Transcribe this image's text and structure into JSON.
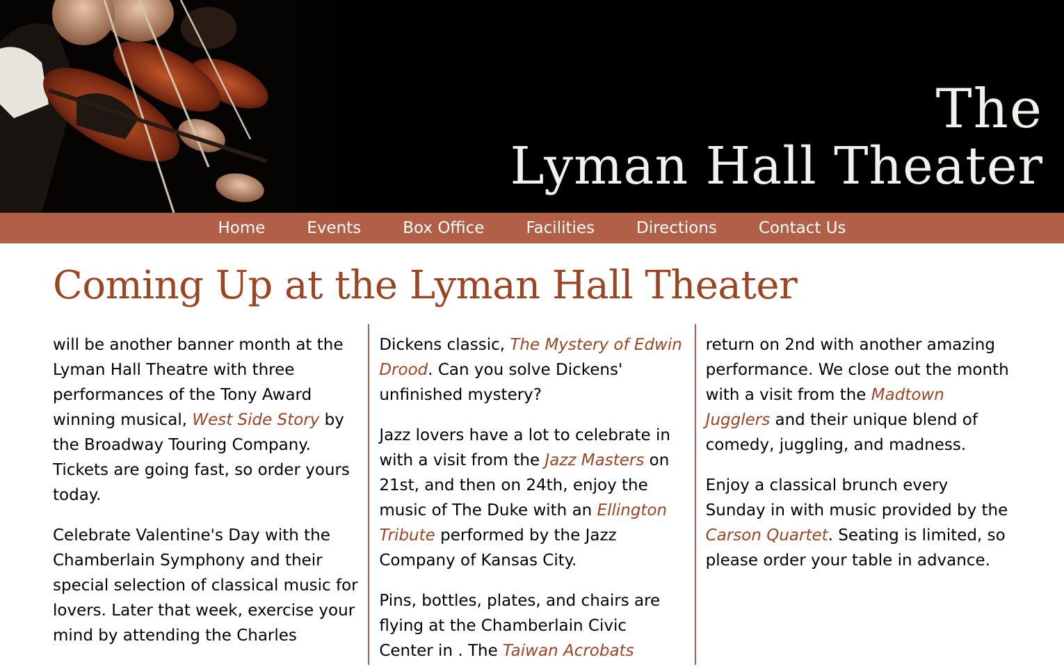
{
  "banner": {
    "title_line1": "The",
    "title_line2": "Lyman Hall Theater",
    "photo_alt": "Violinists performing"
  },
  "nav": {
    "items": [
      "Home",
      "Events",
      "Box Office",
      "Facilities",
      "Directions",
      "Contact Us"
    ]
  },
  "main": {
    "heading": "Coming Up at the Lyman Hall Theater",
    "col1": {
      "p1_a": "will be another banner month at the Lyman Hall Theatre with three performances of the Tony Award winning musical, ",
      "p1_link": "West Side Story",
      "p1_b": " by the Broadway Touring Company. Tickets are going fast, so order yours today.",
      "p2": "Celebrate Valentine's Day with the Chamberlain Symphony and their special selection of classical music for lovers. Later that week, exercise your mind by attending the Charles"
    },
    "col2": {
      "p1_a": "Dickens classic, ",
      "p1_link": "The Mystery of Edwin Drood",
      "p1_b": ". Can you solve Dickens' unfinished mystery?",
      "p2_a": "Jazz lovers have a lot to celebrate in with a visit from the ",
      "p2_link1": "Jazz Masters",
      "p2_b": " on 21st, and then on 24th, enjoy the music of The Duke with an ",
      "p2_link2": "Ellington Tribute",
      "p2_c": " performed by the Jazz Company of Kansas City.",
      "p3_a": "Pins, bottles, plates, and chairs are flying at the Chamberlain Civic Center in . The ",
      "p3_link": "Taiwan Acrobats"
    },
    "col3": {
      "p1_a": "return on 2nd with another amazing performance. We close out the month with a visit from the ",
      "p1_link": "Madtown Jugglers",
      "p1_b": " and their unique blend of comedy, juggling, and madness.",
      "p2_a": "Enjoy a classical brunch every Sunday in with music provided by the ",
      "p2_link": "Carson Quartet",
      "p2_b": ". Seating is limited, so please order your table in advance."
    }
  },
  "colors": {
    "nav_bg": "#b15f47",
    "heading": "#9b4523",
    "link": "#9b4523",
    "banner_bg": "#000000"
  }
}
